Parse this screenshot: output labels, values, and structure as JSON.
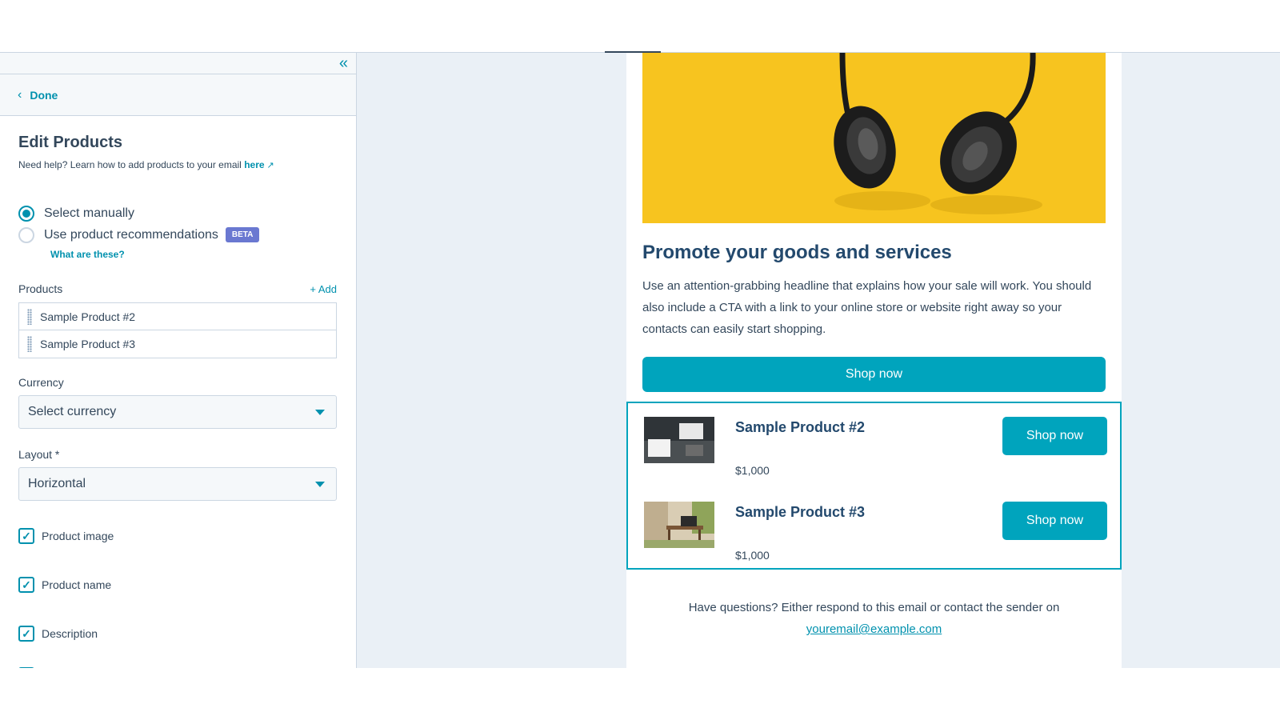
{
  "sidebar": {
    "collapse_icon": "double-chevron-left",
    "done_label": "Done",
    "title": "Edit Products",
    "help_text": "Need help? Learn how to add products to your email",
    "help_link": "here",
    "radio_options": [
      {
        "label": "Select manually",
        "checked": true
      },
      {
        "label": "Use product recommendations",
        "checked": false,
        "badge": "BETA"
      }
    ],
    "what_are_these": "What are these?",
    "products_label": "Products",
    "add_label": "+ Add",
    "products": [
      "Sample Product #2",
      "Sample Product #3"
    ],
    "currency_label": "Currency",
    "currency_value": "Select currency",
    "layout_label": "Layout *",
    "layout_value": "Horizontal",
    "checkboxes": [
      {
        "label": "Product image",
        "checked": true
      },
      {
        "label": "Product name",
        "checked": true
      },
      {
        "label": "Description",
        "checked": true
      }
    ]
  },
  "email": {
    "headline": "Promote your goods and services",
    "body": "Use an attention-grabbing headline that explains how your sale will work. You should also include a CTA with a link to your online store or website right away so your contacts can easily start shopping.",
    "cta_label": "Shop now",
    "products": [
      {
        "name": "Sample Product #2",
        "price": "$1,000",
        "button": "Shop now"
      },
      {
        "name": "Sample Product #3",
        "price": "$1,000",
        "button": "Shop now"
      }
    ],
    "footer_text": "Have questions? Either respond to this email or contact the sender on",
    "footer_email": "youremail@example.com"
  },
  "colors": {
    "accent": "#00a4bd",
    "link": "#0091ae",
    "hero_bg": "#f7c41f",
    "headline": "#23496d",
    "beta_badge": "#6a78d1"
  }
}
